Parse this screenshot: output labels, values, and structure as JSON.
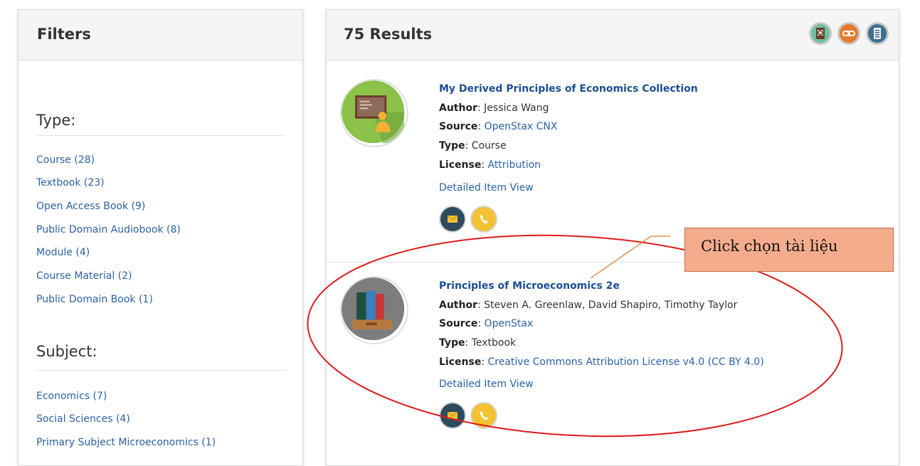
{
  "filters": {
    "title": "Filters",
    "type_heading": "Type:",
    "type_items": [
      "Course (28)",
      "Textbook (23)",
      "Open Access Book (9)",
      "Public Domain Audiobook (8)",
      "Module (4)",
      "Course Material (2)",
      "Public Domain Book (1)"
    ],
    "subject_heading": "Subject:",
    "subject_items": [
      "Economics (7)",
      "Social Sciences (4)",
      "Primary Subject Microeconomics (1)"
    ]
  },
  "results": {
    "title": "75 Results",
    "header_icons": [
      "search-document-icon",
      "link-icon",
      "document-icon"
    ],
    "items": [
      {
        "title": "My Derived Principles of Economics Collection",
        "author_label": "Author",
        "author": ": Jessica Wang",
        "source_label": "Source",
        "source_sep": ": ",
        "source": "OpenStax CNX",
        "type_label": "Type",
        "type": ": Course",
        "license_label": "License",
        "license_sep": ": ",
        "license": "Attribution",
        "detail": "Detailed Item View",
        "thumb_icon": "teacher-board-icon"
      },
      {
        "title": "Principles of Microeconomics 2e",
        "author_label": "Author",
        "author": ": Steven A. Greenlaw, David Shapiro, Timothy Taylor",
        "source_label": "Source",
        "source_sep": ": ",
        "source": "OpenStax",
        "type_label": "Type",
        "type": ": Textbook",
        "license_label": "License",
        "license_sep": ": ",
        "license": "Creative Commons Attribution License v4.0 (CC BY 4.0)",
        "detail": "Detailed Item View",
        "thumb_icon": "books-icon"
      }
    ]
  },
  "annotation": {
    "callout_text": "Click chọn tài liệu",
    "color": "#e01b1b"
  },
  "colors": {
    "link": "#2b62a6",
    "title_link": "#1b4f93",
    "callout_bg": "#f5ac8c"
  }
}
